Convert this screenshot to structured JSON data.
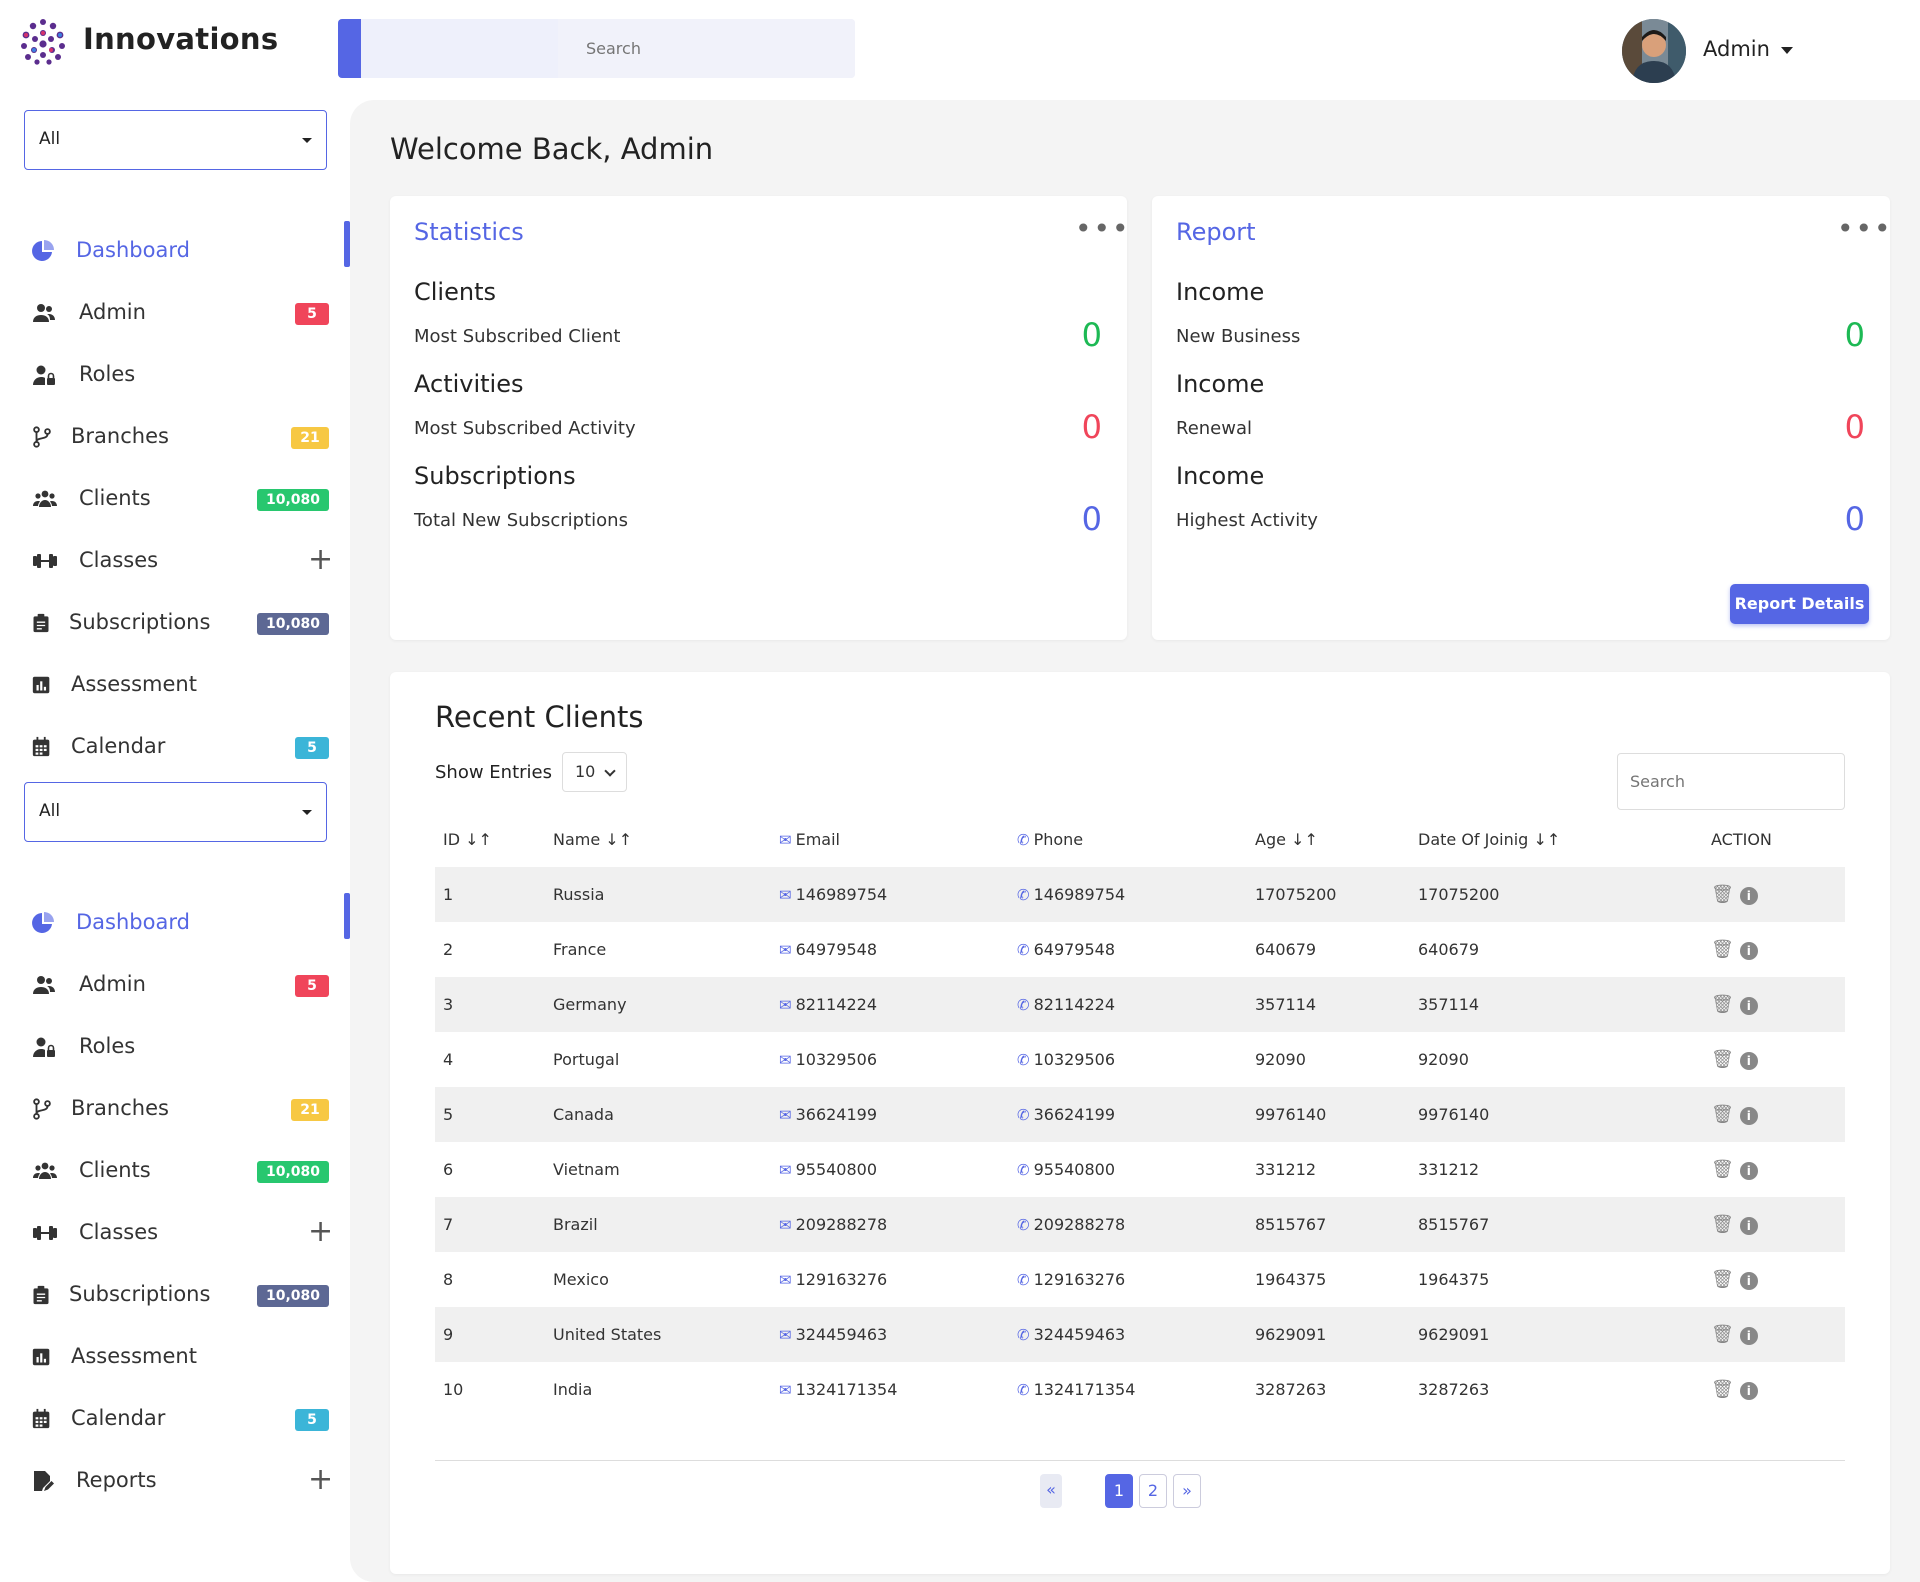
{
  "header": {
    "app_name": "Innovations",
    "search_placeholder": "Search",
    "user_name": "Admin"
  },
  "sidebar_groups": [
    {
      "filter": "All",
      "items": [
        {
          "label": "Dashboard",
          "icon": "pie-chart-icon",
          "active": true
        },
        {
          "label": "Admin",
          "icon": "users-icon",
          "badge": "5",
          "badge_color": "#f0455a"
        },
        {
          "label": "Roles",
          "icon": "user-lock-icon"
        },
        {
          "label": "Branches",
          "icon": "code-branch-icon",
          "badge": "21",
          "badge_color": "#f7c843"
        },
        {
          "label": "Clients",
          "icon": "users-group-icon",
          "badge": "10,080",
          "badge_color": "#28c76f"
        },
        {
          "label": "Classes",
          "icon": "dumbbell-icon",
          "expandable": true
        },
        {
          "label": "Subscriptions",
          "icon": "clipboard-icon",
          "badge": "10,080",
          "badge_color": "#5d6894"
        },
        {
          "label": "Assessment",
          "icon": "chart-bar-icon"
        },
        {
          "label": "Calendar",
          "icon": "calendar-icon",
          "badge": "5",
          "badge_color": "#3bb5d8"
        }
      ]
    },
    {
      "filter": "All",
      "items": [
        {
          "label": "Dashboard",
          "icon": "pie-chart-icon",
          "active": true
        },
        {
          "label": "Admin",
          "icon": "users-icon",
          "badge": "5",
          "badge_color": "#f0455a"
        },
        {
          "label": "Roles",
          "icon": "user-lock-icon"
        },
        {
          "label": "Branches",
          "icon": "code-branch-icon",
          "badge": "21",
          "badge_color": "#f7c843"
        },
        {
          "label": "Clients",
          "icon": "users-group-icon",
          "badge": "10,080",
          "badge_color": "#28c76f"
        },
        {
          "label": "Classes",
          "icon": "dumbbell-icon",
          "expandable": true
        },
        {
          "label": "Subscriptions",
          "icon": "clipboard-icon",
          "badge": "10,080",
          "badge_color": "#5d6894"
        },
        {
          "label": "Assessment",
          "icon": "chart-bar-icon"
        },
        {
          "label": "Calendar",
          "icon": "calendar-icon",
          "badge": "5",
          "badge_color": "#3bb5d8"
        },
        {
          "label": "Reports",
          "icon": "file-edit-icon",
          "expandable": true
        }
      ]
    }
  ],
  "main": {
    "welcome": "Welcome Back, Admin",
    "statistics": {
      "title": "Statistics",
      "rows": [
        {
          "heading": "Clients",
          "label": "Most Subscribed Client",
          "value": "0",
          "color": "#1db954"
        },
        {
          "heading": "Activities",
          "label": "Most Subscribed Activity",
          "value": "0",
          "color": "#f0455a"
        },
        {
          "heading": "Subscriptions",
          "label": "Total New Subscriptions",
          "value": "0",
          "color": "#5566e4"
        }
      ]
    },
    "report": {
      "title": "Report",
      "rows": [
        {
          "heading": "Income",
          "label": "New Business",
          "value": "0",
          "color": "#1db954"
        },
        {
          "heading": "Income",
          "label": "Renewal",
          "value": "0",
          "color": "#f0455a"
        },
        {
          "heading": "Income",
          "label": "Highest Activity",
          "value": "0",
          "color": "#5566e4"
        }
      ],
      "button": "Report Details"
    },
    "clients_table": {
      "title": "Recent Clients",
      "show_entries_label": "Show Entries",
      "entries_value": "10",
      "search_placeholder": "Search",
      "columns": [
        "ID",
        "Name",
        "Email",
        "Phone",
        "Age",
        "Date Of Joinig",
        "ACTION"
      ],
      "rows": [
        [
          "1",
          "Russia",
          "146989754",
          "146989754",
          "17075200",
          "17075200"
        ],
        [
          "2",
          "France",
          "64979548",
          "64979548",
          "640679",
          "640679"
        ],
        [
          "3",
          "Germany",
          "82114224",
          "82114224",
          "357114",
          "357114"
        ],
        [
          "4",
          "Portugal",
          "10329506",
          "10329506",
          "92090",
          "92090"
        ],
        [
          "5",
          "Canada",
          "36624199",
          "36624199",
          "9976140",
          "9976140"
        ],
        [
          "6",
          "Vietnam",
          "95540800",
          "95540800",
          "331212",
          "331212"
        ],
        [
          "7",
          "Brazil",
          "209288278",
          "209288278",
          "8515767",
          "8515767"
        ],
        [
          "8",
          "Mexico",
          "129163276",
          "129163276",
          "1964375",
          "1964375"
        ],
        [
          "9",
          "United States",
          "324459463",
          "324459463",
          "9629091",
          "9629091"
        ],
        [
          "10",
          "India",
          "1324171354",
          "1324171354",
          "3287263",
          "3287263"
        ]
      ],
      "pagination": [
        "«",
        "1",
        "2",
        "»"
      ],
      "current_page": "1"
    },
    "accent_color": "#5566e4"
  }
}
